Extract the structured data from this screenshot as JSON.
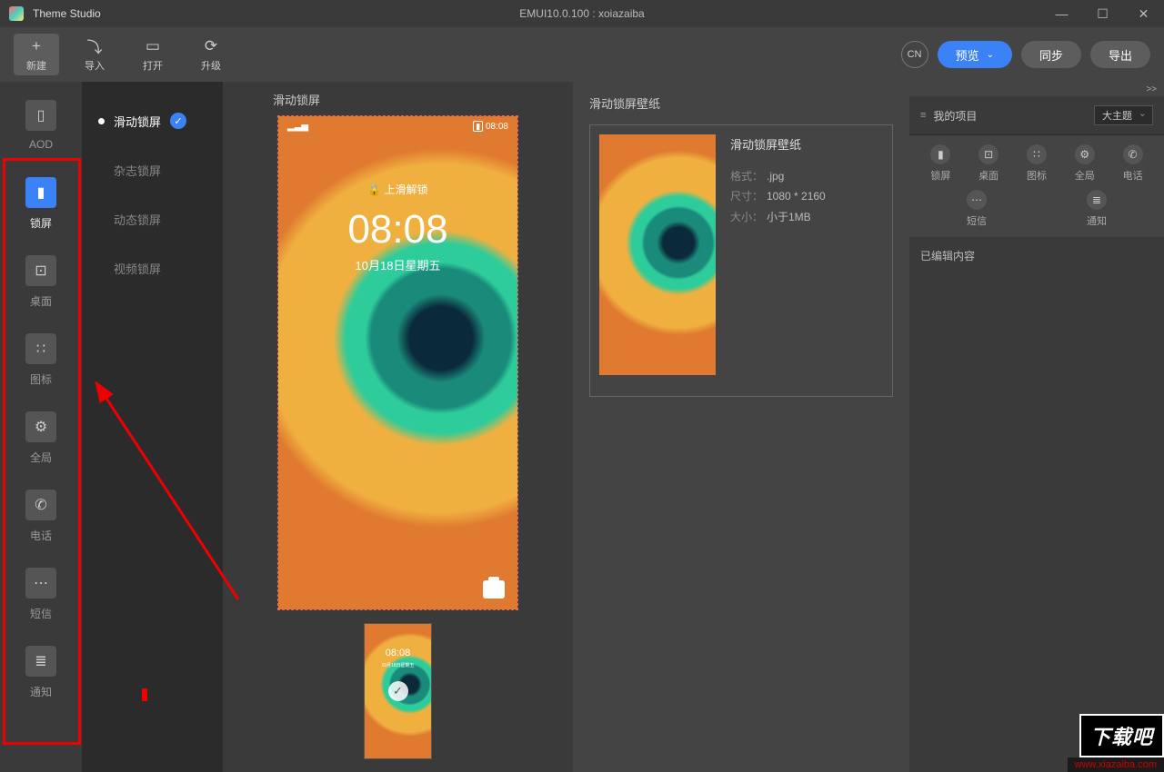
{
  "titlebar": {
    "app": "Theme Studio",
    "doc": "EMUI10.0.100 : xoiazaiba"
  },
  "toolbar": {
    "new": "新建",
    "import": "导入",
    "open": "打开",
    "upgrade": "升级",
    "lang": "CN",
    "preview": "预览",
    "sync": "同步",
    "export": "导出"
  },
  "nav": {
    "aod": "AOD",
    "lock": "锁屏",
    "home": "桌面",
    "icons": "图标",
    "global": "全局",
    "phone": "电话",
    "sms": "短信",
    "notif": "通知"
  },
  "sublist": {
    "slide": "滑动锁屏",
    "magazine": "杂志锁屏",
    "dynamic": "动态锁屏",
    "video": "视频锁屏"
  },
  "canvas": {
    "title": "滑动锁屏",
    "sb_time": "08:08",
    "unlock_hint": "🔒 上滑解锁",
    "time": "08:08",
    "date": "10月18日星期五"
  },
  "wallpanel": {
    "heading": "滑动锁屏壁纸",
    "title": "滑动锁屏壁纸",
    "k_format": "格式：",
    "v_format": ".jpg",
    "k_size": "尺寸：",
    "v_size": "1080 * 2160",
    "k_filesize": "大小：",
    "v_filesize": "小于1MB"
  },
  "right": {
    "project": "我的项目",
    "select": "大主题",
    "icons": {
      "lock": "锁屏",
      "home": "桌面",
      "icon": "图标",
      "global": "全局",
      "phone": "电话",
      "sms": "短信",
      "notif": "通知"
    },
    "edited": "已编辑内容"
  },
  "watermark": {
    "logo": "下载吧",
    "url": "www.xiazaiba.com"
  }
}
